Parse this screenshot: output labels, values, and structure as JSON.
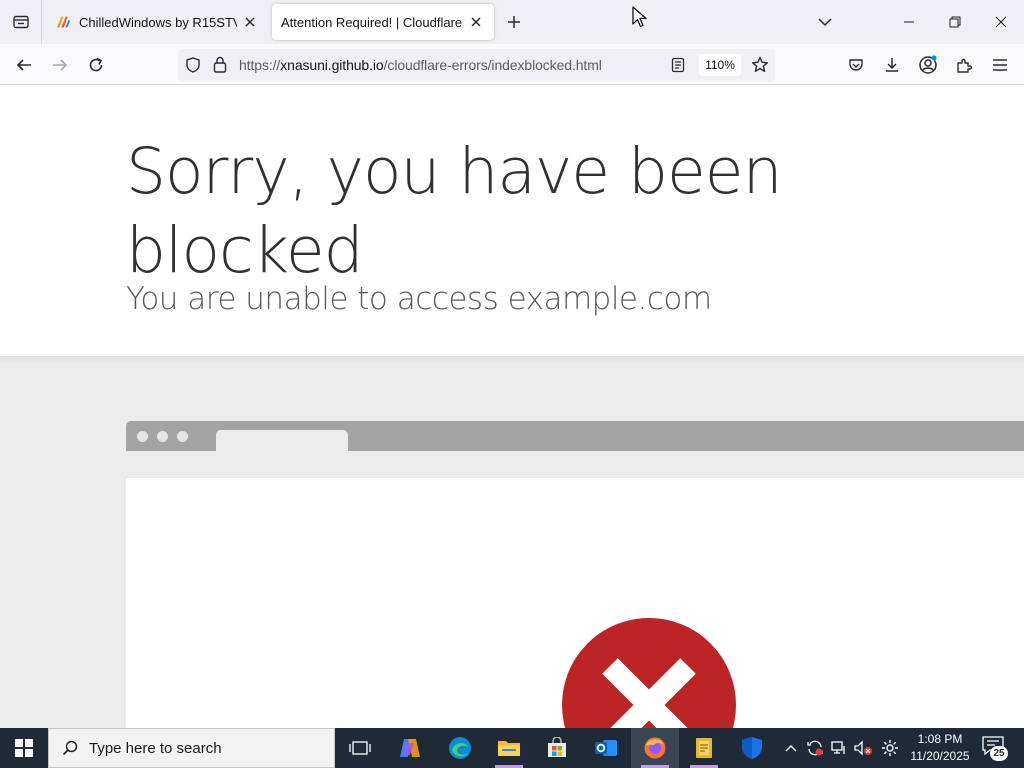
{
  "browser": {
    "tabs": [
      {
        "title": "ChilledWindows by R15STV",
        "active": false
      },
      {
        "title": "Attention Required! | Cloudflare",
        "active": true
      }
    ],
    "url": {
      "scheme": "https://",
      "host": "xnasuni.github.io",
      "path": "/cloudflare-errors/indexblocked.html"
    },
    "zoom": "110%"
  },
  "page": {
    "heading": "Sorry, you have been blocked",
    "subheading": "You are unable to access example.com"
  },
  "taskbar": {
    "search_placeholder": "Type here to search",
    "clock_time": "1:08 PM",
    "clock_date": "11/20/2025",
    "notification_count": "25",
    "pinned_apps": [
      "task-view",
      "copilot",
      "edge",
      "file-explorer",
      "microsoft-store",
      "outlook",
      "firefox",
      "app-notes",
      "windows-security"
    ]
  },
  "colors": {
    "error_red": "#bd2426",
    "taskbar_bg": "#1f2a36",
    "mock_browser_frame": "#a3a3a3"
  }
}
